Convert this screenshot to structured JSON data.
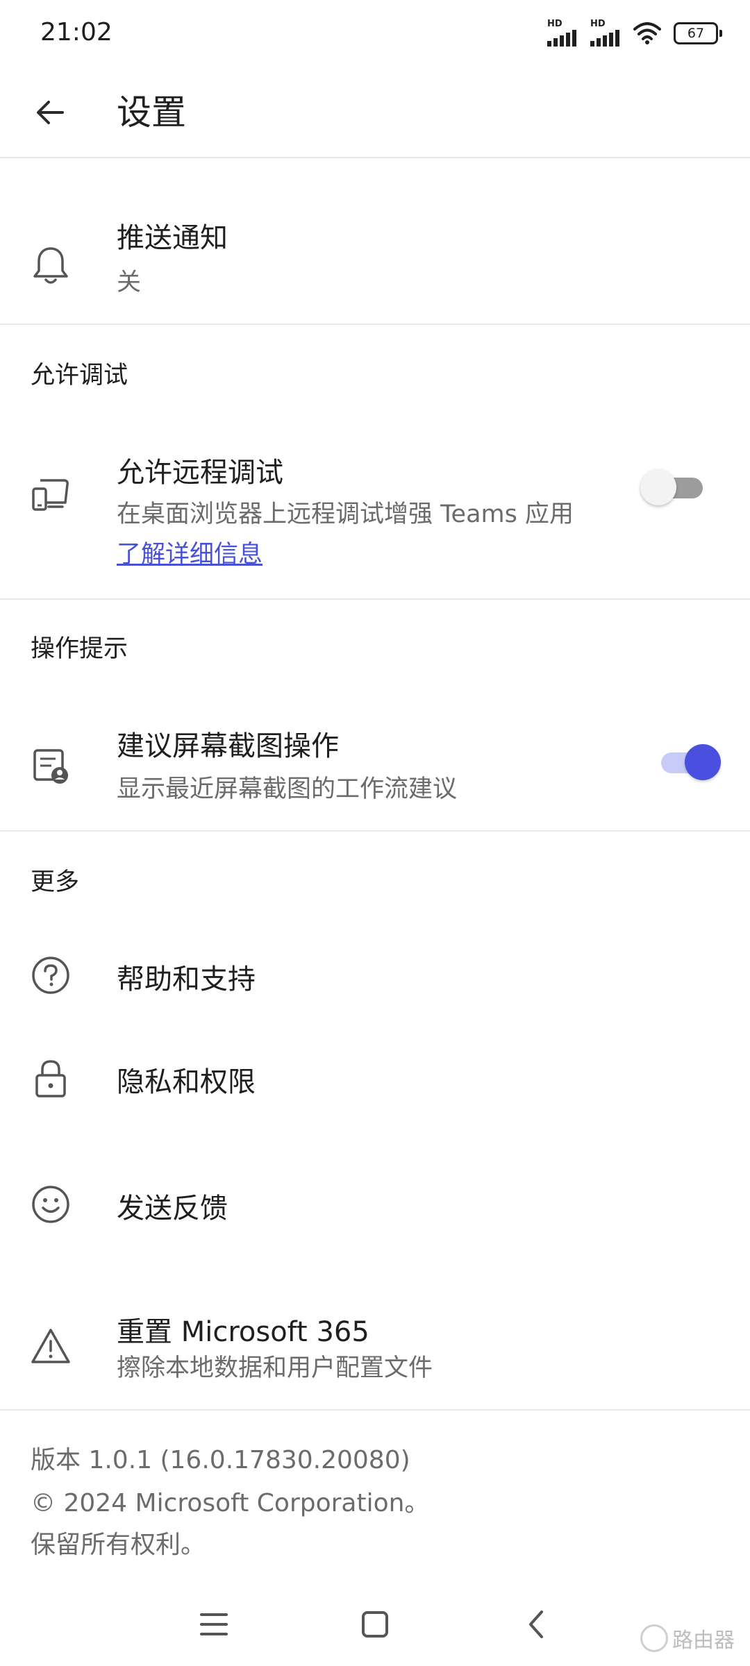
{
  "status_bar": {
    "time": "21:02",
    "signal_badge": "HD",
    "battery_level": "67"
  },
  "header": {
    "title": "设置"
  },
  "push_notification": {
    "title": "推送通知",
    "status": "关"
  },
  "sections": {
    "debug": "允许调试",
    "tips": "操作提示",
    "more": "更多"
  },
  "remote_debug": {
    "title": "允许远程调试",
    "description": "在桌面浏览器上远程调试增强 Teams 应用",
    "link": "了解详细信息",
    "enabled": false
  },
  "screenshot_actions": {
    "title": "建议屏幕截图操作",
    "description": "显示最近屏幕截图的工作流建议",
    "enabled": true
  },
  "more_items": {
    "help": "帮助和支持",
    "privacy": "隐私和权限",
    "feedback": "发送反馈",
    "reset_title": "重置 Microsoft 365",
    "reset_description": "擦除本地数据和用户配置文件"
  },
  "footer": {
    "version": "版本 1.0.1 (16.0.17830.20080)",
    "copyright": "© 2024 Microsoft Corporation。",
    "rights": "保留所有权利。"
  },
  "watermark": "路由器",
  "colors": {
    "accent": "#4a4fe0",
    "link": "#4752d6",
    "secondary_text": "#6b6b6b",
    "divider": "#e9e9e9"
  }
}
